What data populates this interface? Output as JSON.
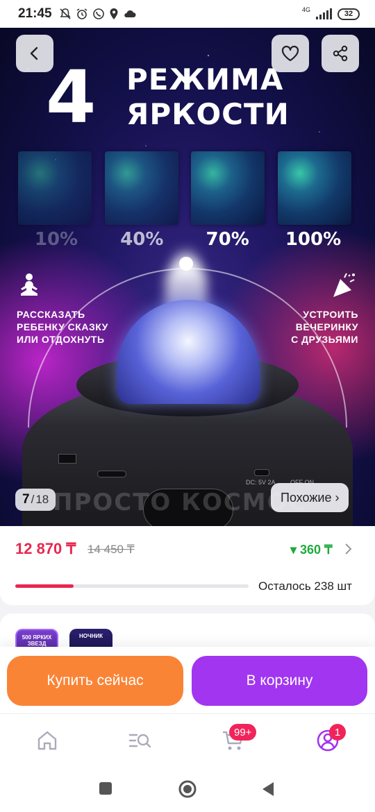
{
  "status_bar": {
    "time": "21:45",
    "network": "4G",
    "battery": "32",
    "icons": [
      "mute-icon",
      "alarm-icon",
      "whatsapp-icon",
      "location-icon",
      "cloud-icon"
    ]
  },
  "gallery": {
    "counter_current": "7",
    "counter_separator": "/",
    "counter_total": "18",
    "similar_label": "Похожие ›",
    "image": {
      "big_number": "4",
      "title_line1": "РЕЖИМА",
      "title_line2": "ЯРКОСТИ",
      "levels": [
        "10%",
        "40%",
        "70%",
        "100%"
      ],
      "left_caption": [
        "РАССКАЗАТЬ",
        "РЕБЕНКУ СКАЗКУ",
        "ИЛИ ОТДОХНУТЬ"
      ],
      "right_caption": [
        "УСТРОИТЬ",
        "ВЕЧЕРИНКУ",
        "С ДРУЗЬЯМИ"
      ],
      "port_label": "DC: 5V 2A",
      "switch_label": "OFF ON",
      "watermark": "ПРОСТО КОСМОС"
    }
  },
  "price": {
    "current": "12 870 ₸",
    "old": "14 450 ₸",
    "bonus": "▾ 360 ₸",
    "stock_text": "Осталось 238 шт",
    "stock_fraction": 0.25
  },
  "variants": [
    {
      "label": "500 ЯРКИХ ЗВЕЗД"
    },
    {
      "label": "НОЧНИК"
    }
  ],
  "actions": {
    "buy_now": "Купить сейчас",
    "add_to_cart": "В корзину"
  },
  "bottom_nav": {
    "cart_badge": "99+",
    "profile_badge": "1"
  },
  "colors": {
    "price": "#e8274f",
    "bonus": "#1faa3c",
    "buy_now": "#fa8436",
    "add_to_cart": "#a135f0",
    "badge": "#f0245a"
  }
}
